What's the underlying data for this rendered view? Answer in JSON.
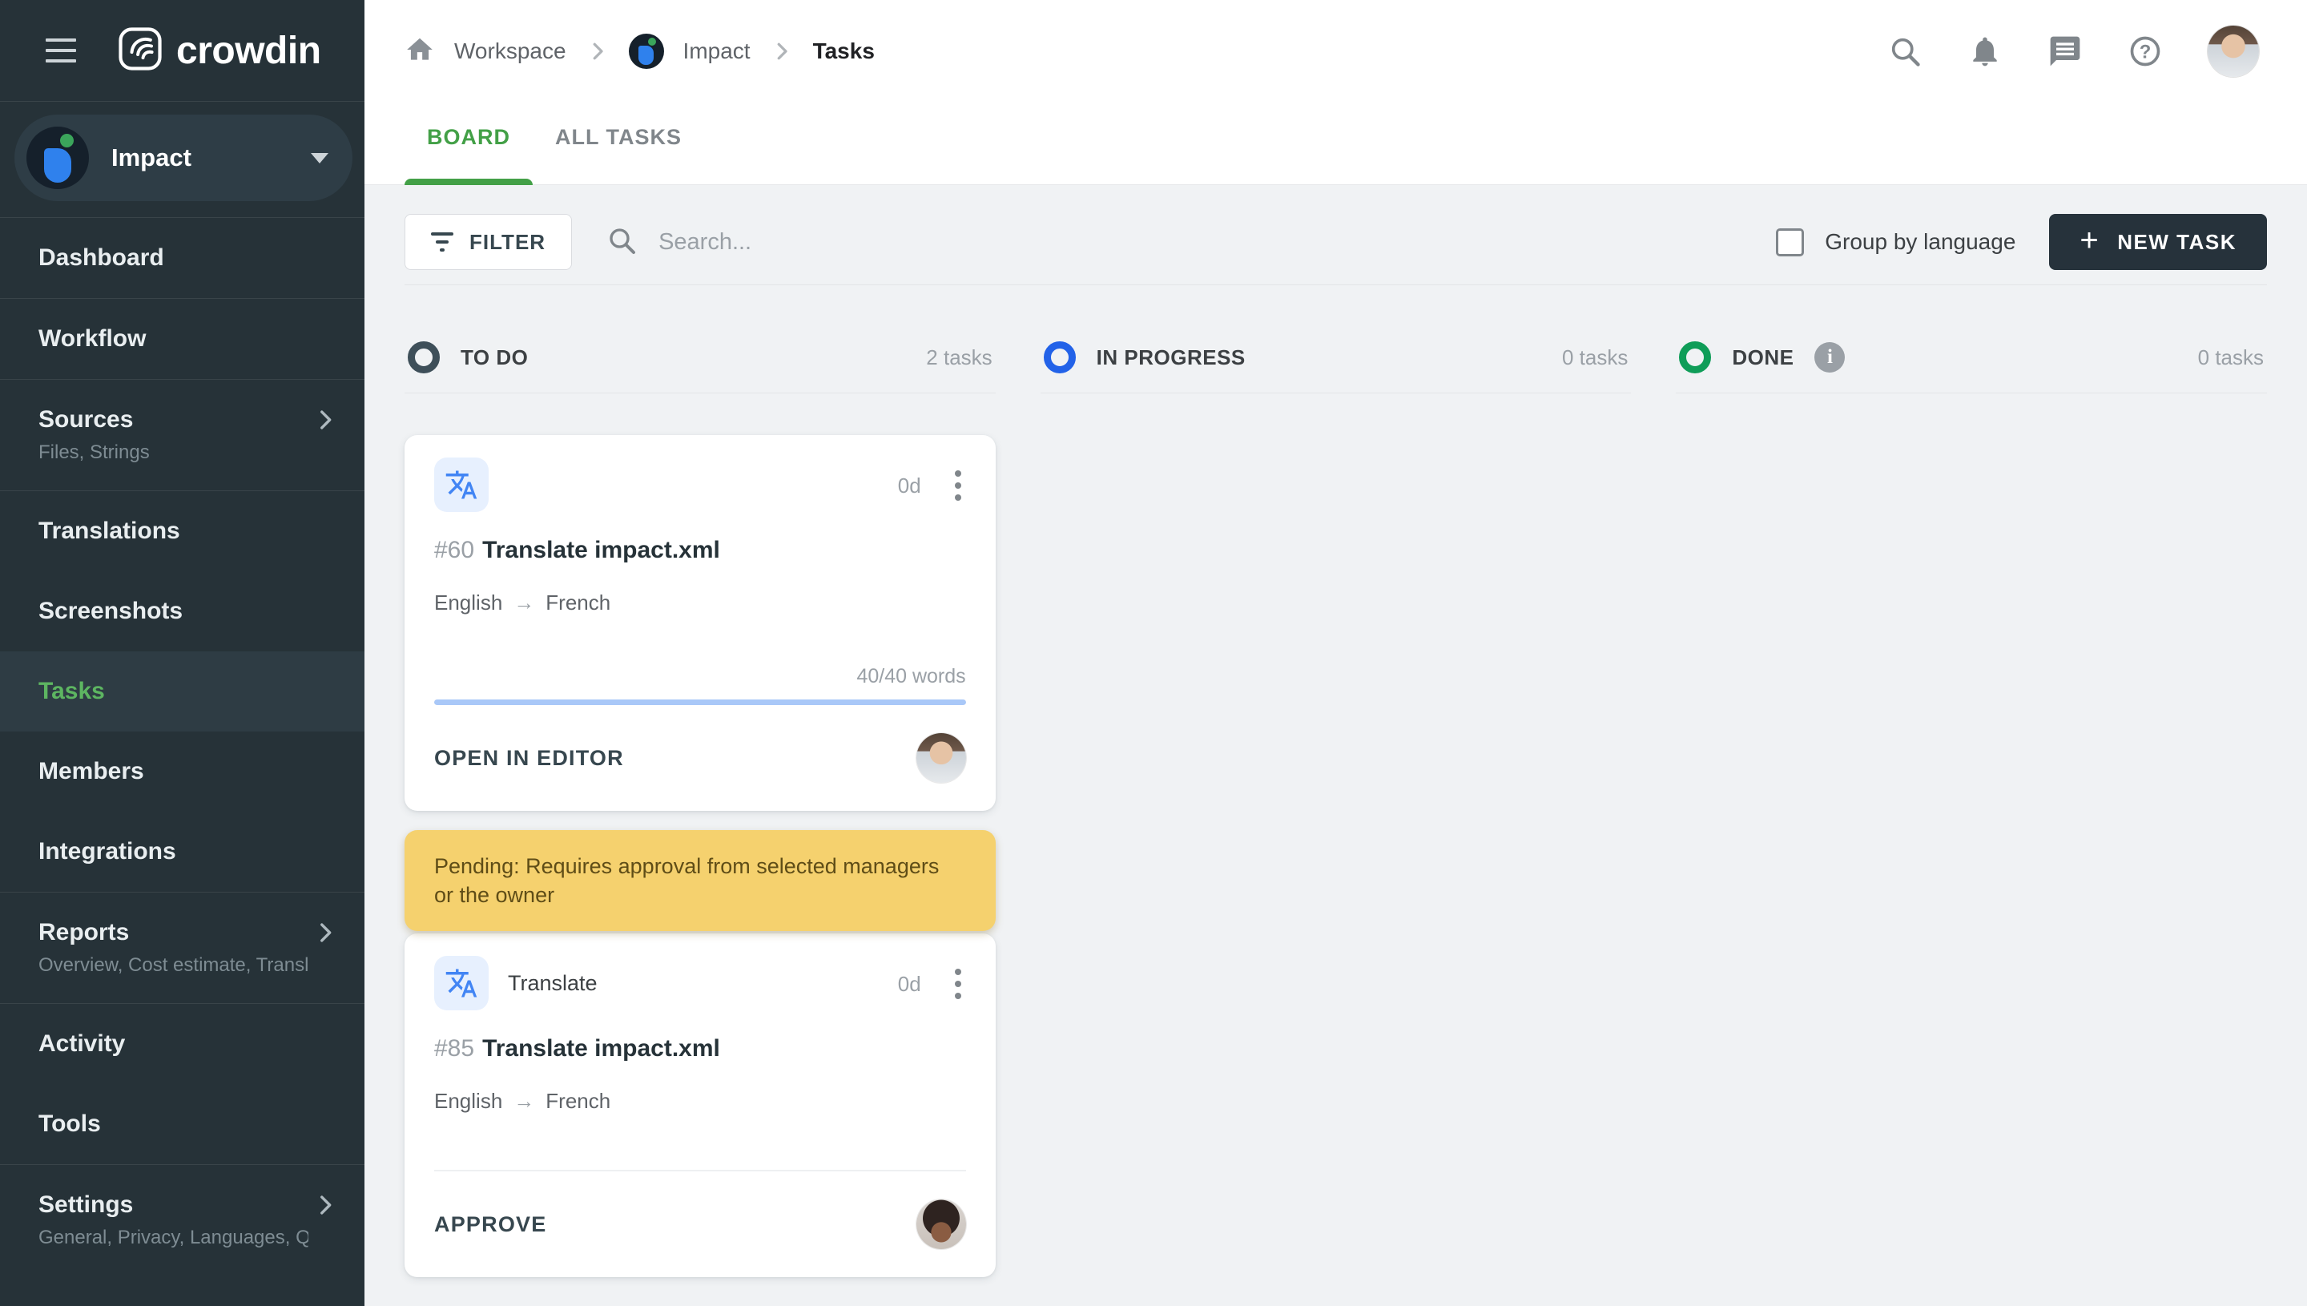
{
  "brand": {
    "wordmark": "crowdin"
  },
  "project_switcher": {
    "name": "Impact"
  },
  "breadcrumb": {
    "workspace": "Workspace",
    "project": "Impact",
    "current": "Tasks"
  },
  "sidebar": {
    "items": [
      {
        "label": "Dashboard"
      },
      {
        "label": "Workflow"
      },
      {
        "label": "Sources",
        "sub": "Files, Strings"
      },
      {
        "label": "Translations"
      },
      {
        "label": "Screenshots"
      },
      {
        "label": "Tasks",
        "active": true
      },
      {
        "label": "Members"
      },
      {
        "label": "Integrations"
      },
      {
        "label": "Reports",
        "sub": "Overview, Cost estimate, Transl…"
      },
      {
        "label": "Activity"
      },
      {
        "label": "Tools"
      },
      {
        "label": "Settings",
        "sub": "General, Privacy, Languages, Q…"
      }
    ]
  },
  "tabs": [
    {
      "label": "BOARD",
      "active": true
    },
    {
      "label": "ALL TASKS",
      "active": false
    }
  ],
  "toolbar": {
    "filter_label": "FILTER",
    "search_placeholder": "Search...",
    "group_by_label": "Group by language",
    "new_task_label": "NEW TASK",
    "plus_glyph": "+"
  },
  "board": {
    "columns": [
      {
        "name": "TO DO",
        "count": "2 tasks",
        "status_color": "#3e4f59"
      },
      {
        "name": "IN PROGRESS",
        "count": "0 tasks",
        "status_color": "#2262e8"
      },
      {
        "name": "DONE",
        "count": "0 tasks",
        "status_color": "#0f9d58",
        "info_glyph": "i"
      }
    ]
  },
  "tasks": [
    {
      "id": "#60",
      "title": "Translate impact.xml",
      "duration": "0d",
      "lang_from": "English",
      "lang_to": "French",
      "words": "40/40 words",
      "progress_percent": 100,
      "action": "OPEN IN EDITOR"
    },
    {
      "pending_note": "Pending: Requires approval from selected managers or the owner",
      "type_label": "Translate",
      "id": "#85",
      "title": "Translate impact.xml",
      "duration": "0d",
      "lang_from": "English",
      "lang_to": "French",
      "action": "APPROVE"
    }
  ],
  "colors": {
    "sidebar_bg": "#263238",
    "accent_green": "#43a047",
    "active_item_green": "#5db561",
    "todo_circle": "#3e4f59",
    "in_progress_circle": "#2262e8",
    "done_circle": "#0f9d58",
    "banner_bg": "#f5d16e",
    "banner_text": "#5f4d17",
    "progress_blue": "#a9c8f8",
    "task_icon_bg": "#e7f0fe",
    "task_icon_glyph": "#4285f4",
    "new_task_bg": "#26323b"
  },
  "icons": {
    "menu-icon": "hamburger",
    "crowdin-logo": "rounded square with wing arcs",
    "chevron-down-icon": "caret",
    "chevron-right-icon": "›",
    "home-icon": "house",
    "search-icon": "magnifier",
    "notifications-icon": "bell",
    "messages-icon": "speech bubble",
    "help-icon": "question mark circle",
    "filter-icon": "filter lines",
    "translate-icon": "文A",
    "kebab-icon": "⋮",
    "info-icon": "i",
    "arrow-right": "→"
  }
}
